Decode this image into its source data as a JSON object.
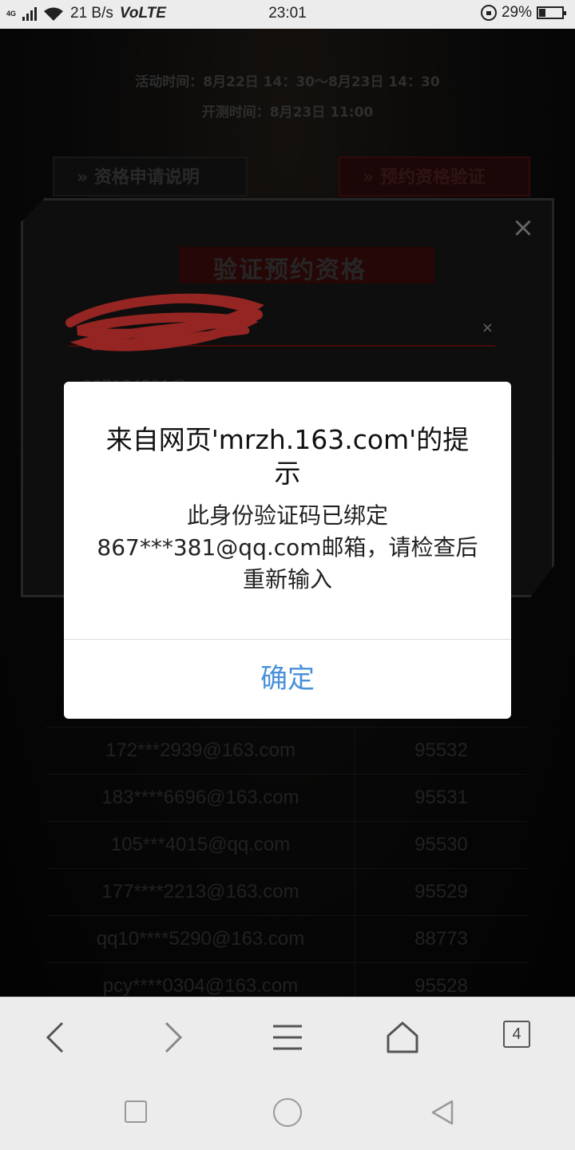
{
  "status_bar": {
    "network": "4G",
    "speed": "21 B/s",
    "volte": "VoLTE",
    "time": "23:01",
    "battery_percent": "29%",
    "battery_level": 0.29
  },
  "page": {
    "activity_time": "活动时间：8月22日 14：30～8月23日 14：30",
    "test_time": "开测时间：8月23日 11:00",
    "btn_left": "资格申请说明",
    "btn_right": "预约资格验证",
    "panel_title": "验证预约资格",
    "field_clear": "×",
    "close": "×",
    "partial_email": "867104881@",
    "table_rows": [
      {
        "email": "172***2939@163.com",
        "code": "95532"
      },
      {
        "email": "183****6696@163.com",
        "code": "95531"
      },
      {
        "email": "105***4015@qq.com",
        "code": "95530"
      },
      {
        "email": "177****2213@163.com",
        "code": "95529"
      },
      {
        "email": "qq10****5290@163.com",
        "code": "88773"
      },
      {
        "email": "pcy****0304@163.com",
        "code": "95528"
      }
    ]
  },
  "dialog": {
    "title": "来自网页'mrzh.163.com'的提示",
    "message": "此身份验证码已绑定867***381@qq.com邮箱，请检查后重新输入",
    "ok": "确定"
  },
  "toolbar": {
    "back_icon": "chevron-left-icon",
    "forward_icon": "chevron-right-icon",
    "menu_icon": "menu-icon",
    "home_icon": "home-icon",
    "tab_count": "4"
  },
  "colors": {
    "accent": "#4a90d9",
    "dialog_bg": "#ffffff",
    "bar_bg": "#ececec"
  }
}
